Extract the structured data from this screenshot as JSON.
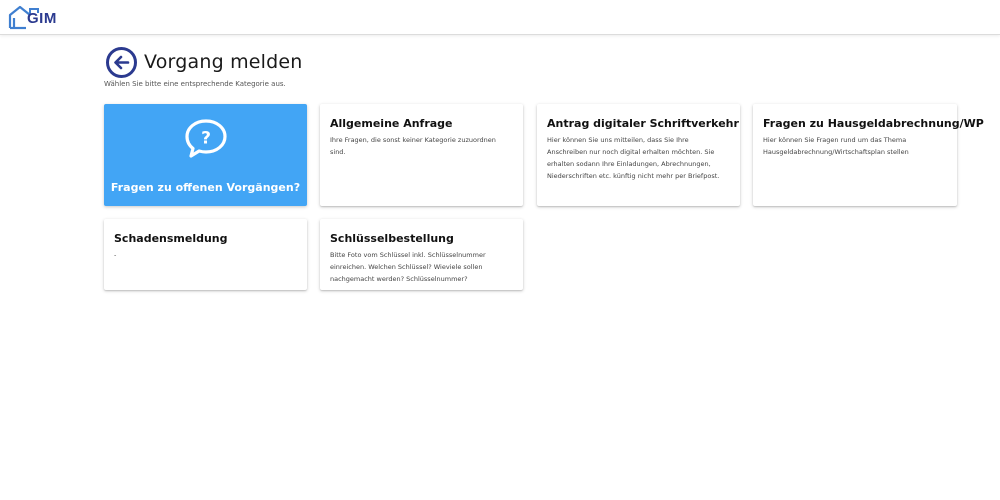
{
  "app": {
    "logo_text": "GIM"
  },
  "page": {
    "title": "Vorgang melden",
    "subtitle": "Wählen Sie bitte eine entsprechende Kategorie aus."
  },
  "cards": {
    "primary": {
      "label": "Fragen zu offenen Vorgängen?",
      "icon": "question-bubble-icon"
    },
    "items": [
      {
        "title": "Allgemeine Anfrage",
        "text": "Ihre Fragen, die sonst keiner Kategorie zuzuordnen sind."
      },
      {
        "title": "Antrag digitaler Schriftverkehr",
        "text": "Hier können Sie uns mitteilen, dass Sie Ihre Anschreiben nur noch digital erhalten möchten. Sie erhalten sodann Ihre Einladungen, Abrechnungen, Niederschriften etc. künftig nicht mehr per Briefpost."
      },
      {
        "title": "Fragen zu Hausgeldabrechnung/WP",
        "text": "Hier können Sie Fragen rund um das Thema Hausgeldabrechnung/Wirtschaftsplan stellen"
      },
      {
        "title": "Schadensmeldung",
        "text": "-"
      },
      {
        "title": "Schlüsselbestellung",
        "text": "Bitte Foto vom Schlüssel inkl. Schlüsselnummer einreichen. Welchen Schlüssel? Wieviele sollen nachgemacht werden? Schlüsselnummer?"
      }
    ]
  },
  "colors": {
    "primary_card": "#42a5f5",
    "brand": "#2b3a8f",
    "logo_house": "#3f7fd0"
  }
}
